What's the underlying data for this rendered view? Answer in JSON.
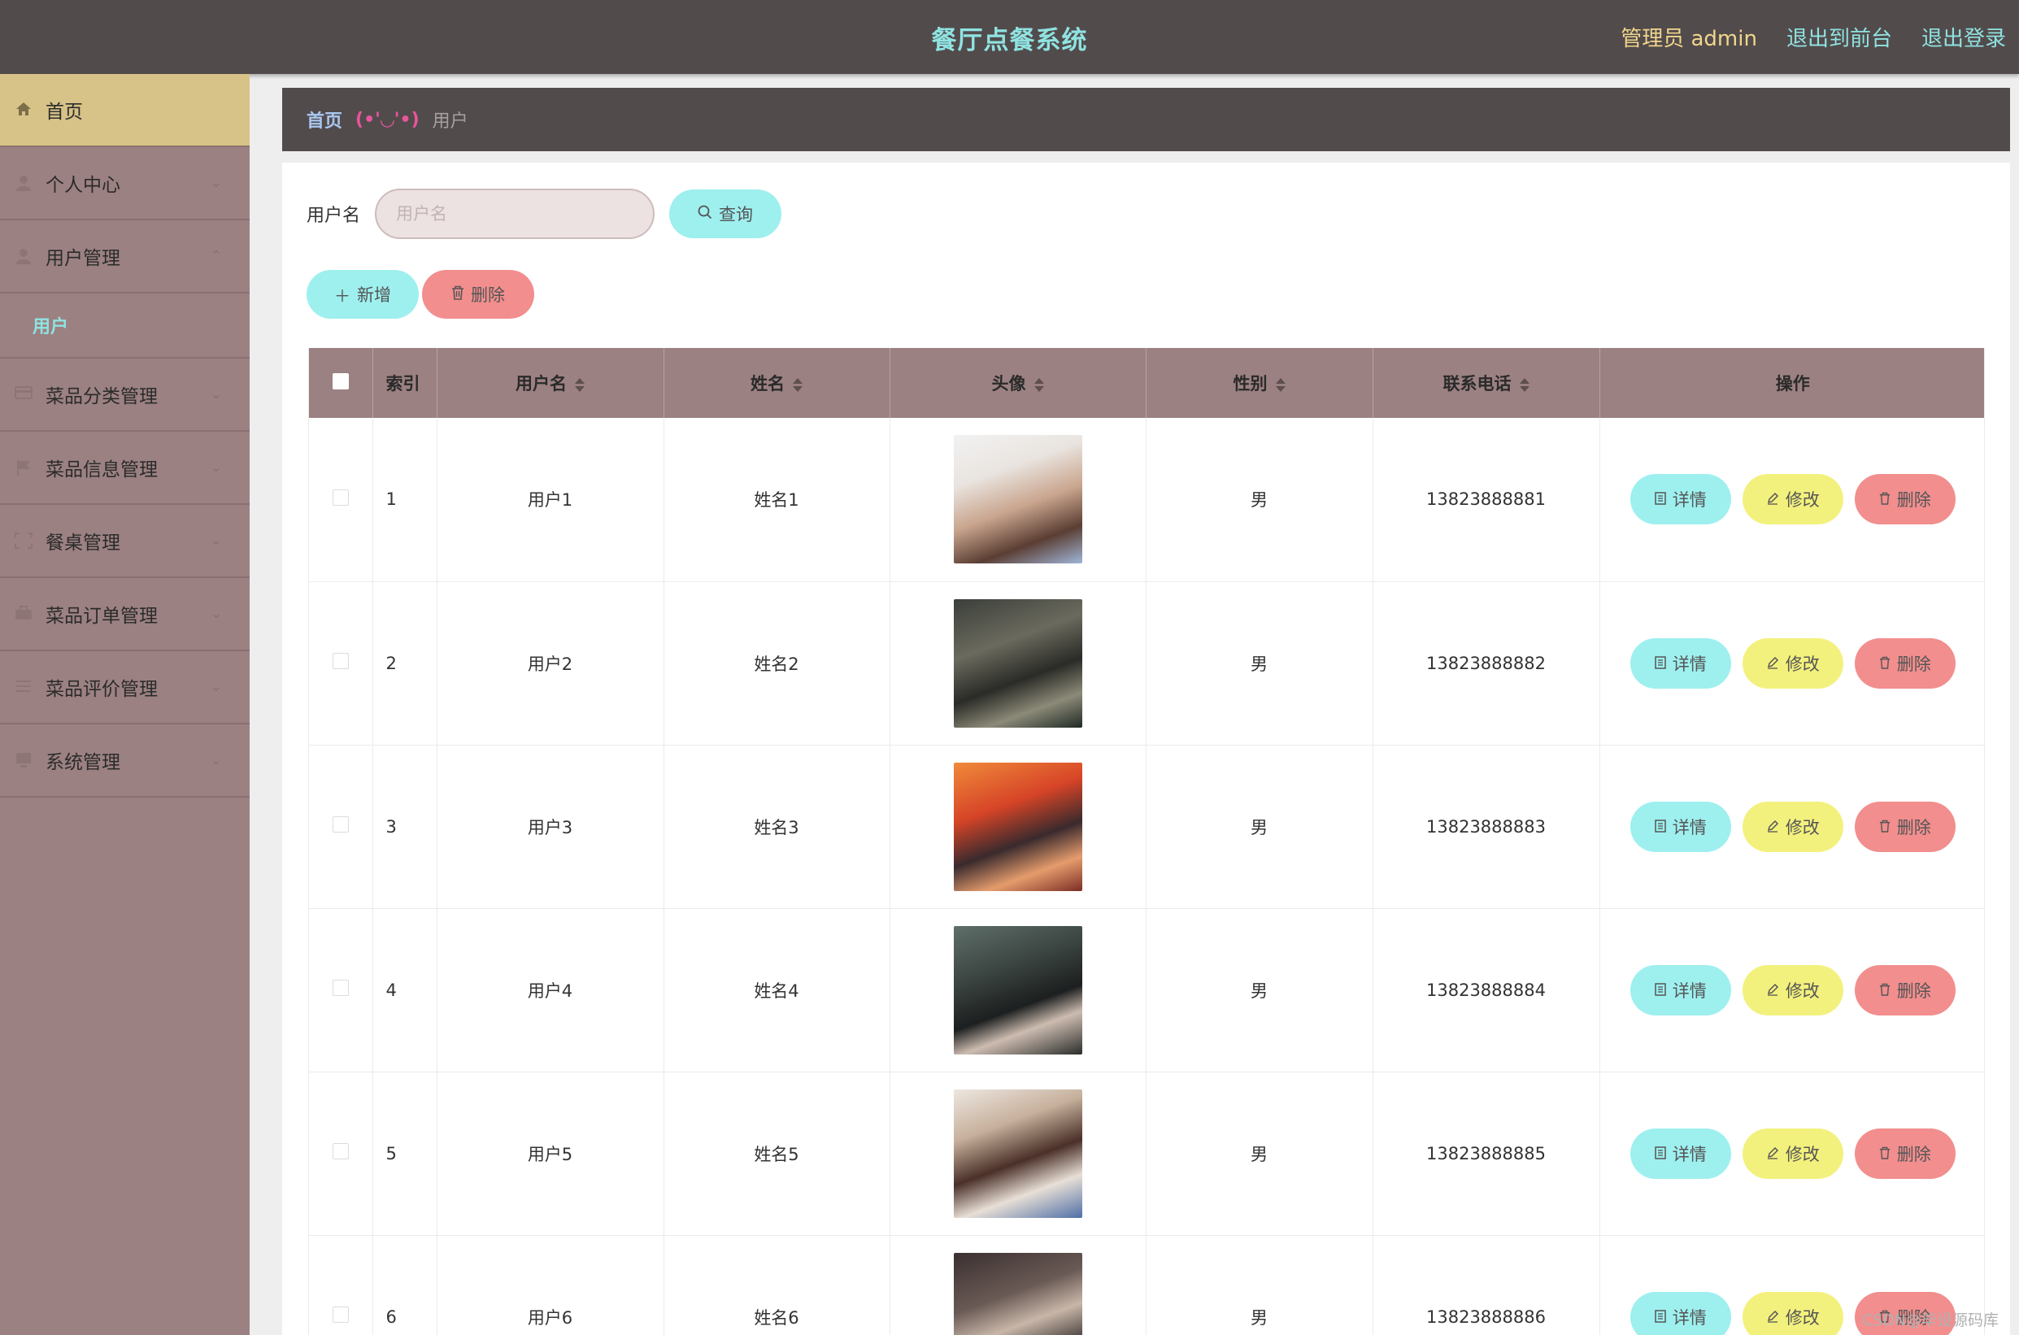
{
  "header": {
    "app_title": "餐厅点餐系统",
    "admin_label": "管理员 admin",
    "front_link": "退出到前台",
    "logout_link": "退出登录"
  },
  "sidebar": {
    "items": [
      {
        "label": "首页",
        "icon": "home-icon",
        "active": true
      },
      {
        "label": "个人中心",
        "icon": "user-icon"
      },
      {
        "label": "用户管理",
        "icon": "user-icon",
        "expanded": true
      },
      {
        "label": "菜品分类管理",
        "icon": "card-icon"
      },
      {
        "label": "菜品信息管理",
        "icon": "flag-icon"
      },
      {
        "label": "餐桌管理",
        "icon": "frame-icon"
      },
      {
        "label": "菜品订单管理",
        "icon": "briefcase-icon"
      },
      {
        "label": "菜品评价管理",
        "icon": "list-icon"
      },
      {
        "label": "系统管理",
        "icon": "monitor-icon"
      }
    ],
    "submenu": {
      "label": "用户"
    }
  },
  "breadcrumb": {
    "home": "首页",
    "separator": "(•'◡'•)",
    "current": "用户"
  },
  "search": {
    "label": "用户名",
    "placeholder": "用户名",
    "value": "",
    "query_button": "查询"
  },
  "actions": {
    "add_button": "新增",
    "delete_button": "删除"
  },
  "table": {
    "columns": [
      "索引",
      "用户名",
      "姓名",
      "头像",
      "性别",
      "联系电话",
      "操作"
    ],
    "rows": [
      {
        "index": "1",
        "username": "用户1",
        "name": "姓名1",
        "gender": "男",
        "phone": "13823888881"
      },
      {
        "index": "2",
        "username": "用户2",
        "name": "姓名2",
        "gender": "男",
        "phone": "13823888882"
      },
      {
        "index": "3",
        "username": "用户3",
        "name": "姓名3",
        "gender": "男",
        "phone": "13823888883"
      },
      {
        "index": "4",
        "username": "用户4",
        "name": "姓名4",
        "gender": "男",
        "phone": "13823888884"
      },
      {
        "index": "5",
        "username": "用户5",
        "name": "姓名5",
        "gender": "男",
        "phone": "13823888885"
      },
      {
        "index": "6",
        "username": "用户6",
        "name": "姓名6",
        "gender": "男",
        "phone": "13823888886"
      }
    ],
    "row_actions": {
      "detail": "详情",
      "edit": "修改",
      "delete": "删除"
    }
  },
  "watermark": "CSDN@毕设源码库",
  "colors": {
    "header_bg": "#524b4c",
    "sidebar_bg": "#9c8182",
    "active_item": "#d7c387",
    "accent_cyan": "#9ef0ef",
    "accent_yellow": "#f3f17d",
    "accent_pink": "#f28e8e",
    "title_color": "#8fe3e1"
  }
}
